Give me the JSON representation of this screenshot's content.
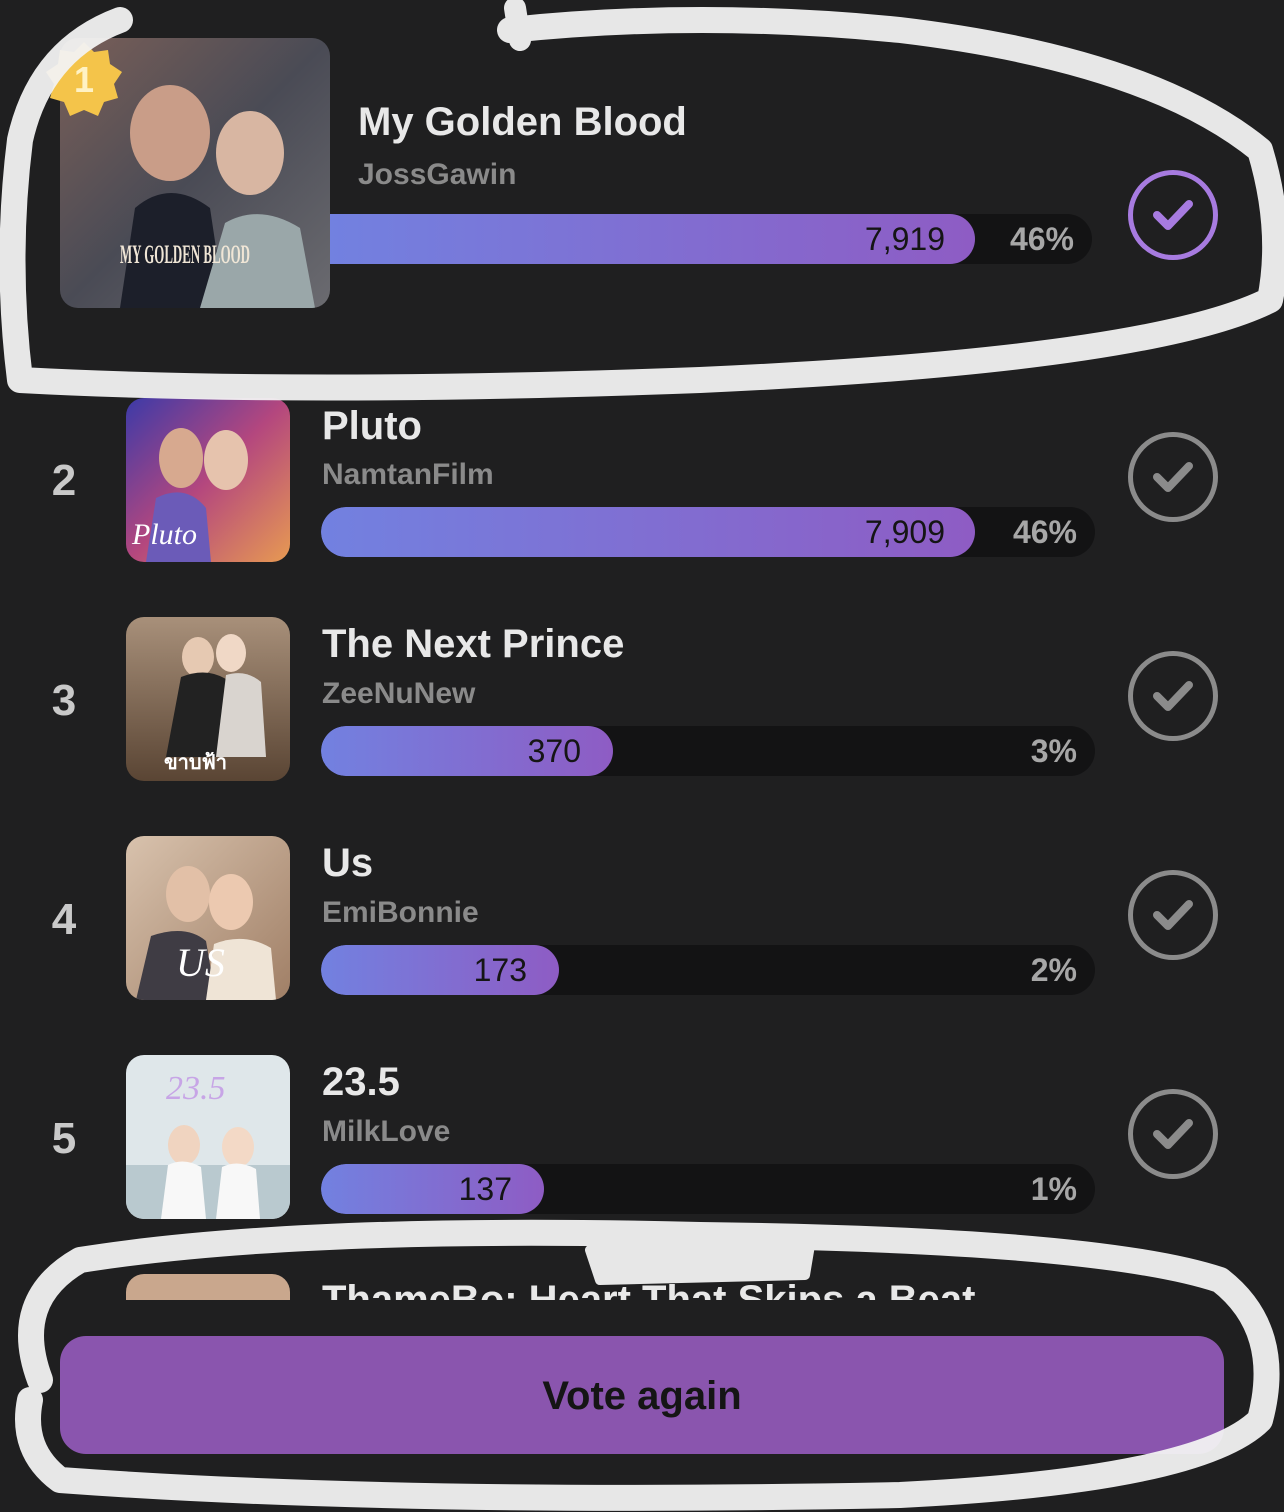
{
  "colors": {
    "background": "#1f1f20",
    "bar_start": "#7281e0",
    "bar_end": "#8e5cc4",
    "selected_check": "#a77be0",
    "button": "#8a55ae"
  },
  "results": [
    {
      "rank": "1",
      "title": "My Golden Blood",
      "artist": "JossGawin",
      "votes": "7,919",
      "percent": "46%",
      "fraction": 0.46,
      "selected": true,
      "poster_text": "MY GOLDEN BLOOD"
    },
    {
      "rank": "2",
      "title": "Pluto",
      "artist": "NamtanFilm",
      "votes": "7,909",
      "percent": "46%",
      "fraction": 0.46,
      "selected": false,
      "poster_text": "Pluto"
    },
    {
      "rank": "3",
      "title": "The Next Prince",
      "artist": "ZeeNuNew",
      "votes": "370",
      "percent": "3%",
      "fraction": 0.03,
      "selected": false,
      "poster_text": "ขาบฟ้า"
    },
    {
      "rank": "4",
      "title": "Us",
      "artist": "EmiBonnie",
      "votes": "173",
      "percent": "2%",
      "fraction": 0.02,
      "selected": false,
      "poster_text": "US"
    },
    {
      "rank": "5",
      "title": "23.5",
      "artist": "MilkLove",
      "votes": "137",
      "percent": "1%",
      "fraction": 0.01,
      "selected": false,
      "poster_text": "23.5"
    }
  ],
  "partial_item_title": "ThameBo: Heart That Skips a Beat",
  "vote_again_label": "Vote again"
}
